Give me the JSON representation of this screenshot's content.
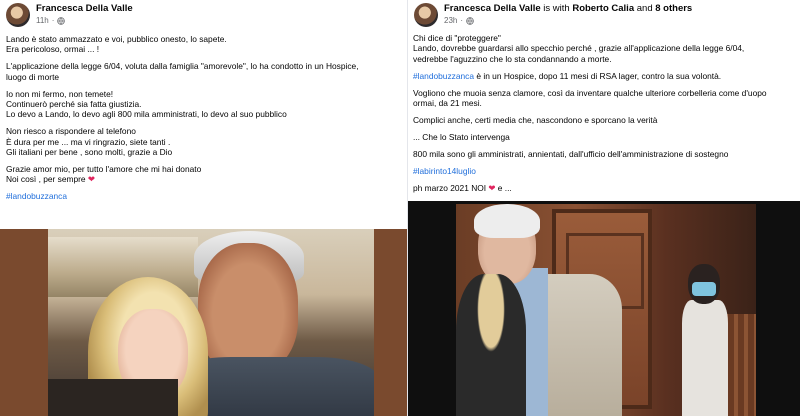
{
  "left_post": {
    "author": "Francesca Della Valle",
    "timestamp": "11h",
    "lines": [
      "Lando è stato ammazzato e voi, pubblico onesto, lo sapete.",
      "Era pericoloso, ormai ... !",
      "",
      "L'applicazione della legge 6/04, voluta dalla famiglia \"amorevole\", lo ha condotto in un Hospice,",
      "luogo di morte",
      "",
      "Io non mi fermo, non temete!",
      "Continuerò perché sia fatta giustizia.",
      "Lo devo a Lando, lo devo agli 800 mila amministrati, lo devo al suo pubblico",
      "",
      "Non riesco a rispondere al telefono",
      "È dura per me ... ma vi ringrazio, siete tanti .",
      "Gli italiani per bene , sono molti, grazie a Dio",
      "",
      "Grazie amor mio, per tutto l'amore che mi hai donato",
      "Noi così , per sempre"
    ],
    "heart": "❤",
    "hashtag": "#landobuzzanca"
  },
  "right_post": {
    "author": "Francesca Della Valle",
    "with_text": "is with",
    "tagged_person": "Roberto Calia",
    "and_text": "and",
    "others": "8 others",
    "timestamp": "23h",
    "lines_a": [
      "Chi dice di \"proteggere\"",
      "Lando, dovrebbe guardarsi allo specchio perché , grazie all'applicazione della legge 6/04,",
      "vedrebbe l'aguzzino che lo sta condannando a morte."
    ],
    "hashtag_line_tag": "#landobuzzanca",
    "hashtag_line_rest": " è in un Hospice, dopo 11 mesi di RSA lager, contro la sua volontà.",
    "lines_b": [
      "Vogliono che muoia senza clamore, così da inventare qualche ulteriore corbelleria come d'uopo",
      "ormai, da 21 mesi.",
      "",
      "Complici anche, certi media che, nascondono e sporcano la verità",
      "",
      "... Che lo Stato intervenga",
      "",
      "800 mila sono gli amministrati, annientati, dall'ufficio dell'amministrazione di sostegno"
    ],
    "hashtag2": "#labirinto14luglio",
    "photo_credit_prefix": "ph marzo 2021 NOI",
    "heart": "❤",
    "photo_credit_suffix": "e ..."
  }
}
